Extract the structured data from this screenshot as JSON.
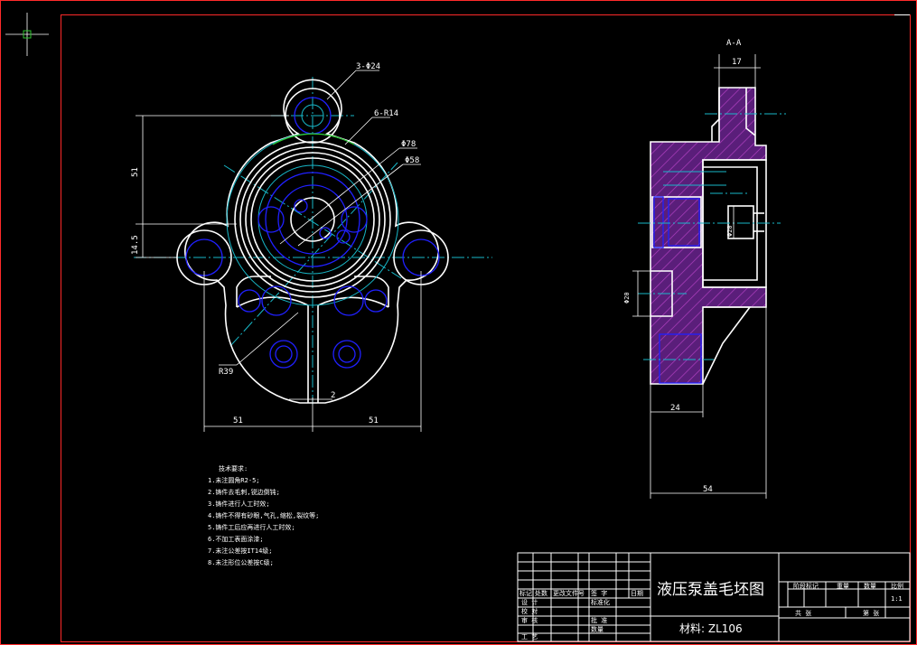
{
  "drawing": {
    "title": "液压泵盖毛坯图",
    "material": "材料: ZL106",
    "section_label": "A-A"
  },
  "dimensions": {
    "d_3phi24": "3-Φ24",
    "d_6r14": "6-R14",
    "d_phi78": "Φ78",
    "d_phi58": "Φ58",
    "d_51v": "51",
    "d_145": "14.5",
    "d_r39": "R39",
    "d_2": "2",
    "d_51a": "51",
    "d_51b": "51",
    "d_17": "17",
    "d_phi20a": "Φ20",
    "d_phi20b": "Φ20",
    "d_24": "24",
    "d_54": "54"
  },
  "tech_notes": {
    "heading": "技术要求:",
    "lines": [
      "1.未注圆角R2-5;",
      "2.铸件去毛刺,锐边倒钝;",
      "3.铸件进行人工时效;",
      "4.铸件不得有砂眼,气孔,缩松,裂纹等;",
      "5.铸件工后应再进行人工时效;",
      "6.不加工表面涂漆;",
      "7.未注公差按IT14级;",
      "8.未注形位公差按C级;"
    ]
  },
  "title_block": {
    "marks": "标记",
    "count": "处数",
    "doc_no": "更改文件号",
    "sign": "签 字",
    "date": "日期",
    "design": "设 计",
    "standard": "标准化",
    "drafting": "校 对",
    "review": "审 核",
    "craft": "工 艺",
    "approve": "批 准",
    "stage_mark": "阶段标记",
    "weight": "重量",
    "ratio": "比例",
    "ratio_val": "1:1",
    "sheets_total": "共 张",
    "sheet_no": "第 张",
    "qty": "数量"
  },
  "colors": {
    "background": "#000000",
    "outline": "#ffffff",
    "hidden": "#2020ff",
    "center": "#18b8c8",
    "hatch": "#7a2a9a",
    "frame": "#ff2a2a"
  }
}
